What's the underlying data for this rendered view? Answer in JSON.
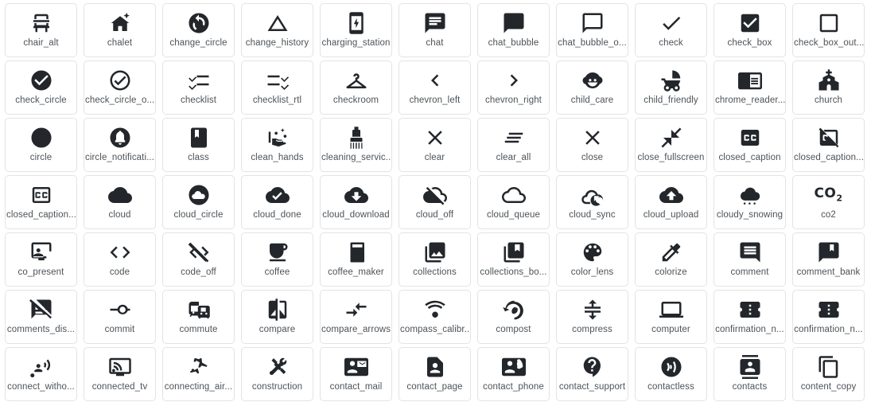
{
  "gallery": {
    "columns": 11,
    "rows": 7,
    "icon_color": "#23272b",
    "label_color": "#4d5358",
    "card_border_color": "#e3e3e3",
    "background": "#ffffff",
    "icons": [
      {
        "label": "chair_alt",
        "icon": "chair-alt-icon"
      },
      {
        "label": "chalet",
        "icon": "chalet-icon"
      },
      {
        "label": "change_circle",
        "icon": "change-circle-icon"
      },
      {
        "label": "change_history",
        "icon": "change-history-icon"
      },
      {
        "label": "charging_station",
        "icon": "charging-station-icon"
      },
      {
        "label": "chat",
        "icon": "chat-icon"
      },
      {
        "label": "chat_bubble",
        "icon": "chat-bubble-icon"
      },
      {
        "label": "chat_bubble_o...",
        "icon": "chat-bubble-outline-icon"
      },
      {
        "label": "check",
        "icon": "check-icon"
      },
      {
        "label": "check_box",
        "icon": "check-box-icon"
      },
      {
        "label": "check_box_out...",
        "icon": "check-box-outline-blank-icon"
      },
      {
        "label": "check_circle",
        "icon": "check-circle-icon"
      },
      {
        "label": "check_circle_o...",
        "icon": "check-circle-outline-icon"
      },
      {
        "label": "checklist",
        "icon": "checklist-icon"
      },
      {
        "label": "checklist_rtl",
        "icon": "checklist-rtl-icon"
      },
      {
        "label": "checkroom",
        "icon": "checkroom-icon"
      },
      {
        "label": "chevron_left",
        "icon": "chevron-left-icon"
      },
      {
        "label": "chevron_right",
        "icon": "chevron-right-icon"
      },
      {
        "label": "child_care",
        "icon": "child-care-icon"
      },
      {
        "label": "child_friendly",
        "icon": "child-friendly-icon"
      },
      {
        "label": "chrome_reader...",
        "icon": "chrome-reader-mode-icon"
      },
      {
        "label": "church",
        "icon": "church-icon"
      },
      {
        "label": "circle",
        "icon": "circle-icon"
      },
      {
        "label": "circle_notificati...",
        "icon": "circle-notifications-icon"
      },
      {
        "label": "class",
        "icon": "class-icon"
      },
      {
        "label": "clean_hands",
        "icon": "clean-hands-icon"
      },
      {
        "label": "cleaning_servic...",
        "icon": "cleaning-services-icon"
      },
      {
        "label": "clear",
        "icon": "clear-icon"
      },
      {
        "label": "clear_all",
        "icon": "clear-all-icon"
      },
      {
        "label": "close",
        "icon": "close-icon"
      },
      {
        "label": "close_fullscreen",
        "icon": "close-fullscreen-icon"
      },
      {
        "label": "closed_caption",
        "icon": "closed-caption-icon"
      },
      {
        "label": "closed_caption...",
        "icon": "closed-caption-disabled-icon"
      },
      {
        "label": "closed_caption...",
        "icon": "closed-caption-off-icon"
      },
      {
        "label": "cloud",
        "icon": "cloud-icon"
      },
      {
        "label": "cloud_circle",
        "icon": "cloud-circle-icon"
      },
      {
        "label": "cloud_done",
        "icon": "cloud-done-icon"
      },
      {
        "label": "cloud_download",
        "icon": "cloud-download-icon"
      },
      {
        "label": "cloud_off",
        "icon": "cloud-off-icon"
      },
      {
        "label": "cloud_queue",
        "icon": "cloud-queue-icon"
      },
      {
        "label": "cloud_sync",
        "icon": "cloud-sync-icon"
      },
      {
        "label": "cloud_upload",
        "icon": "cloud-upload-icon"
      },
      {
        "label": "cloudy_snowing",
        "icon": "cloudy-snowing-icon"
      },
      {
        "label": "co2",
        "icon": "co2-icon"
      },
      {
        "label": "co_present",
        "icon": "co-present-icon"
      },
      {
        "label": "code",
        "icon": "code-icon"
      },
      {
        "label": "code_off",
        "icon": "code-off-icon"
      },
      {
        "label": "coffee",
        "icon": "coffee-icon"
      },
      {
        "label": "coffee_maker",
        "icon": "coffee-maker-icon"
      },
      {
        "label": "collections",
        "icon": "collections-icon"
      },
      {
        "label": "collections_bo...",
        "icon": "collections-bookmark-icon"
      },
      {
        "label": "color_lens",
        "icon": "color-lens-icon"
      },
      {
        "label": "colorize",
        "icon": "colorize-icon"
      },
      {
        "label": "comment",
        "icon": "comment-icon"
      },
      {
        "label": "comment_bank",
        "icon": "comment-bank-icon"
      },
      {
        "label": "comments_dis...",
        "icon": "comments-disabled-icon"
      },
      {
        "label": "commit",
        "icon": "commit-icon"
      },
      {
        "label": "commute",
        "icon": "commute-icon"
      },
      {
        "label": "compare",
        "icon": "compare-icon"
      },
      {
        "label": "compare_arrows",
        "icon": "compare-arrows-icon"
      },
      {
        "label": "compass_calibr...",
        "icon": "compass-calibration-icon"
      },
      {
        "label": "compost",
        "icon": "compost-icon"
      },
      {
        "label": "compress",
        "icon": "compress-icon"
      },
      {
        "label": "computer",
        "icon": "computer-icon"
      },
      {
        "label": "confirmation_n...",
        "icon": "confirmation-number-icon"
      },
      {
        "label": "confirmation_n...",
        "icon": "confirmation-number-alt-icon"
      },
      {
        "label": "connect_witho...",
        "icon": "connect-without-contact-icon"
      },
      {
        "label": "connected_tv",
        "icon": "connected-tv-icon"
      },
      {
        "label": "connecting_air...",
        "icon": "connecting-airports-icon"
      },
      {
        "label": "construction",
        "icon": "construction-icon"
      },
      {
        "label": "contact_mail",
        "icon": "contact-mail-icon"
      },
      {
        "label": "contact_page",
        "icon": "contact-page-icon"
      },
      {
        "label": "contact_phone",
        "icon": "contact-phone-icon"
      },
      {
        "label": "contact_support",
        "icon": "contact-support-icon"
      },
      {
        "label": "contactless",
        "icon": "contactless-icon"
      },
      {
        "label": "contacts",
        "icon": "contacts-icon"
      },
      {
        "label": "content_copy",
        "icon": "content-copy-icon"
      }
    ]
  }
}
